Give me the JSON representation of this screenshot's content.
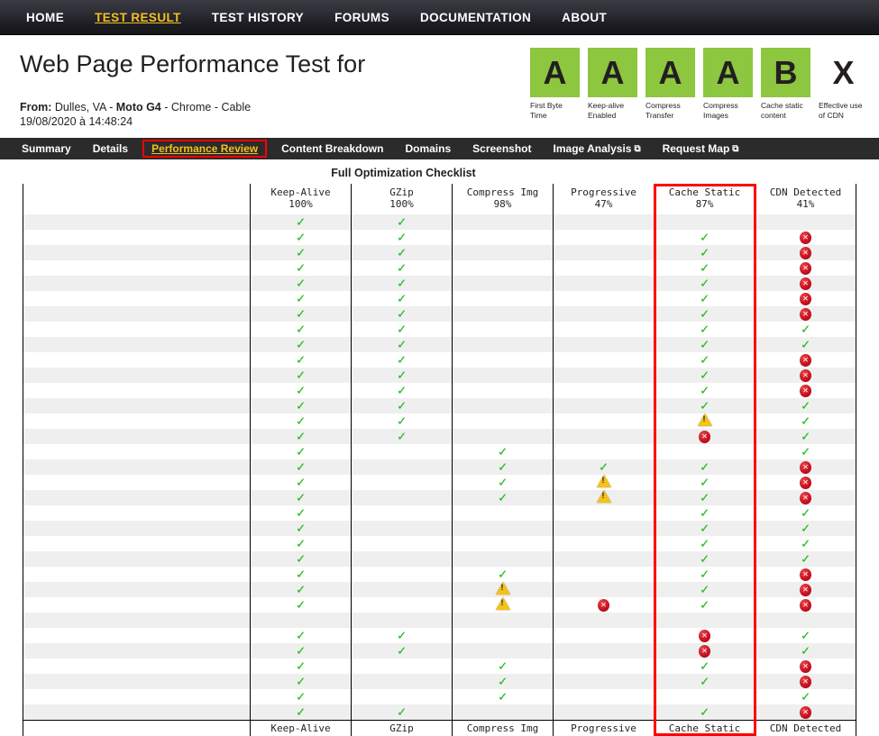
{
  "topnav": {
    "items": [
      {
        "label": "HOME",
        "active": false
      },
      {
        "label": "TEST RESULT",
        "active": true
      },
      {
        "label": "TEST HISTORY",
        "active": false
      },
      {
        "label": "FORUMS",
        "active": false
      },
      {
        "label": "DOCUMENTATION",
        "active": false
      },
      {
        "label": "ABOUT",
        "active": false
      }
    ]
  },
  "header": {
    "title": "Web Page Performance Test for",
    "from_label": "From:",
    "from_value": "Dulles, VA - Moto G4 - Chrome - Cable",
    "location": "Dulles, VA",
    "device": "Moto G4",
    "browser": "Chrome",
    "connection": "Cable",
    "timestamp": "19/08/2020 à 14:48:24"
  },
  "grades": [
    {
      "grade": "A",
      "label": "First Byte Time",
      "color": "#8dc63f"
    },
    {
      "grade": "A",
      "label": "Keep-alive Enabled",
      "color": "#8dc63f"
    },
    {
      "grade": "A",
      "label": "Compress Transfer",
      "color": "#8dc63f"
    },
    {
      "grade": "A",
      "label": "Compress Images",
      "color": "#8dc63f"
    },
    {
      "grade": "B",
      "label": "Cache static content",
      "color": "#8dc63f"
    },
    {
      "grade": "X",
      "label": "Effective use of CDN",
      "color": "transparent"
    }
  ],
  "subnav": {
    "items": [
      {
        "label": "Summary",
        "active": false,
        "external": false
      },
      {
        "label": "Details",
        "active": false,
        "external": false
      },
      {
        "label": "Performance Review",
        "active": true,
        "external": false
      },
      {
        "label": "Content Breakdown",
        "active": false,
        "external": false
      },
      {
        "label": "Domains",
        "active": false,
        "external": false
      },
      {
        "label": "Screenshot",
        "active": false,
        "external": false
      },
      {
        "label": "Image Analysis",
        "active": false,
        "external": true
      },
      {
        "label": "Request Map",
        "active": false,
        "external": true
      }
    ]
  },
  "checklist": {
    "title": "Full Optimization Checklist",
    "highlight_column": "Cache Static",
    "highlight_color": "#ff0000",
    "columns": [
      {
        "name": "Keep-Alive",
        "percent": "100%"
      },
      {
        "name": "GZip",
        "percent": "100%"
      },
      {
        "name": "Compress Img",
        "percent": "98%"
      },
      {
        "name": "Progressive",
        "percent": "47%"
      },
      {
        "name": "Cache Static",
        "percent": "87%"
      },
      {
        "name": "CDN Detected",
        "percent": "41%"
      }
    ],
    "icon_glyphs": {
      "ok": "✓",
      "err": "✕",
      "warn": "!",
      "none": ""
    },
    "rows": [
      [
        "ok",
        "ok",
        "",
        "",
        "",
        ""
      ],
      [
        "ok",
        "ok",
        "",
        "",
        "ok",
        "err"
      ],
      [
        "ok",
        "ok",
        "",
        "",
        "ok",
        "err"
      ],
      [
        "ok",
        "ok",
        "",
        "",
        "ok",
        "err"
      ],
      [
        "ok",
        "ok",
        "",
        "",
        "ok",
        "err"
      ],
      [
        "ok",
        "ok",
        "",
        "",
        "ok",
        "err"
      ],
      [
        "ok",
        "ok",
        "",
        "",
        "ok",
        "err"
      ],
      [
        "ok",
        "ok",
        "",
        "",
        "ok",
        "ok"
      ],
      [
        "ok",
        "ok",
        "",
        "",
        "ok",
        "ok"
      ],
      [
        "ok",
        "ok",
        "",
        "",
        "ok",
        "err"
      ],
      [
        "ok",
        "ok",
        "",
        "",
        "ok",
        "err"
      ],
      [
        "ok",
        "ok",
        "",
        "",
        "ok",
        "err"
      ],
      [
        "ok",
        "ok",
        "",
        "",
        "ok",
        "ok"
      ],
      [
        "ok",
        "ok",
        "",
        "",
        "warn",
        "ok"
      ],
      [
        "ok",
        "ok",
        "",
        "",
        "err",
        "ok"
      ],
      [
        "ok",
        "",
        "ok",
        "",
        "",
        "ok"
      ],
      [
        "ok",
        "",
        "ok",
        "ok",
        "ok",
        "err"
      ],
      [
        "ok",
        "",
        "ok",
        "warn",
        "ok",
        "err"
      ],
      [
        "ok",
        "",
        "ok",
        "warn",
        "ok",
        "err"
      ],
      [
        "ok",
        "",
        "",
        "",
        "ok",
        "ok"
      ],
      [
        "ok",
        "",
        "",
        "",
        "ok",
        "ok"
      ],
      [
        "ok",
        "",
        "",
        "",
        "ok",
        "ok"
      ],
      [
        "ok",
        "",
        "",
        "",
        "ok",
        "ok"
      ],
      [
        "ok",
        "",
        "ok",
        "",
        "ok",
        "err"
      ],
      [
        "ok",
        "",
        "warn",
        "",
        "ok",
        "err"
      ],
      [
        "ok",
        "",
        "warn",
        "err",
        "ok",
        "err"
      ],
      [
        "",
        "",
        "",
        "",
        "",
        ""
      ],
      [
        "ok",
        "ok",
        "",
        "",
        "err",
        "ok"
      ],
      [
        "ok",
        "ok",
        "",
        "",
        "err",
        "ok"
      ],
      [
        "ok",
        "",
        "ok",
        "",
        "ok",
        "err"
      ],
      [
        "ok",
        "",
        "ok",
        "",
        "ok",
        "err"
      ],
      [
        "ok",
        "",
        "ok",
        "",
        "",
        "ok"
      ],
      [
        "ok",
        "ok",
        "",
        "",
        "ok",
        "err"
      ]
    ]
  }
}
